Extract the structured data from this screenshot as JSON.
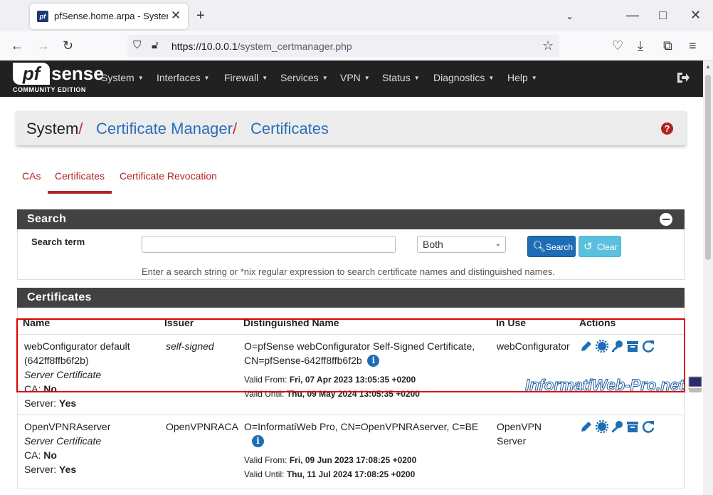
{
  "browser": {
    "tab_title": "pfSense.home.arpa - System: C",
    "tab_favicon": "pf",
    "url_host": "https://10.0.0.1",
    "url_path": "/system_certmanager.php"
  },
  "header": {
    "logo_pf": "pf",
    "logo_sense": "sense",
    "logo_sub": "COMMUNITY EDITION",
    "menu": [
      "System",
      "Interfaces",
      "Firewall",
      "Services",
      "VPN",
      "Status",
      "Diagnostics",
      "Help"
    ]
  },
  "breadcrumb": {
    "root": "System",
    "sep": "/",
    "level1": "Certificate Manager",
    "level2": "Certificates",
    "help_icon": "?"
  },
  "tabs": [
    "CAs",
    "Certificates",
    "Certificate Revocation"
  ],
  "search": {
    "panel_title": "Search",
    "label": "Search term",
    "input_value": "",
    "select_value": "Both",
    "search_button": "Search",
    "clear_button": "Clear",
    "help_text": "Enter a search string or *nix regular expression to search certificate names and distinguished names."
  },
  "certificates": {
    "panel_title": "Certificates",
    "columns": [
      "Name",
      "Issuer",
      "Distinguished Name",
      "In Use",
      "Actions"
    ],
    "rows": [
      {
        "name": "webConfigurator default",
        "name_id": "(642ff8ffb6f2b)",
        "type": "Server Certificate",
        "ca_label": "CA:",
        "ca_value": "No",
        "server_label": "Server:",
        "server_value": "Yes",
        "issuer": "self-signed",
        "dn_line1": "O=pfSense webConfigurator Self-Signed Certificate,",
        "dn_line2": "CN=pfSense-642ff8ffb6f2b",
        "valid_from_label": "Valid From:",
        "valid_from": "Fri, 07 Apr 2023 13:05:35 +0200",
        "valid_until_label": "Valid Until:",
        "valid_until": "Thu, 09 May 2024 13:05:35 +0200",
        "in_use_1": "webConfigurator",
        "in_use_2": ""
      },
      {
        "name": "OpenVPNRAserver",
        "name_id": "",
        "type": "Server Certificate",
        "ca_label": "CA:",
        "ca_value": "No",
        "server_label": "Server:",
        "server_value": "Yes",
        "issuer": "OpenVPNRACA",
        "dn_line1": "O=InformatiWeb Pro, CN=OpenVPNRAserver, C=BE",
        "dn_line2": "",
        "valid_from_label": "Valid From:",
        "valid_from": "Fri, 09 Jun 2023 17:08:25 +0200",
        "valid_until_label": "Valid Until:",
        "valid_until": "Thu, 11 Jul 2024 17:08:25 +0200",
        "in_use_1": "OpenVPN",
        "in_use_2": "Server"
      }
    ],
    "action_icons": [
      "pencil-icon",
      "gear-icon",
      "key-icon",
      "archive-icon",
      "renew-icon"
    ],
    "info_icon": "i"
  },
  "watermark": "InformatiWeb-Pro.net",
  "colors": {
    "accent_red": "#b22222",
    "link_blue": "#2a6ebb",
    "panel_dark": "#424242",
    "btn_primary": "#1e6db5",
    "btn_info": "#5bc0de",
    "highlight": "#e00000"
  }
}
